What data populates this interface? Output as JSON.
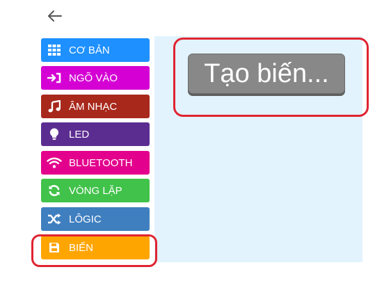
{
  "back_icon": "arrow-left-icon",
  "categories": [
    {
      "label": "CƠ BẢN",
      "color": "#1e90ff",
      "icon": "grid-icon"
    },
    {
      "label": "NGÕ VÀO",
      "color": "#d400d4",
      "icon": "login-icon"
    },
    {
      "label": "ÂM NHẠC",
      "color": "#a8281b",
      "icon": "music-note-icon"
    },
    {
      "label": "LED",
      "color": "#5c2d91",
      "icon": "lightbulb-icon"
    },
    {
      "label": "BLUETOOTH",
      "color": "#e3008c",
      "icon": "wifi-icon"
    },
    {
      "label": "VÒNG LẶP",
      "color": "#41c24a",
      "icon": "refresh-icon"
    },
    {
      "label": "LÔGIC",
      "color": "#3f7fbf",
      "icon": "shuffle-icon"
    },
    {
      "label": "BIẾN",
      "color": "#ffa500",
      "icon": "save-icon"
    }
  ],
  "workspace": {
    "make_variable_label": "Tạo biến..."
  },
  "highlight_color": "#e02430"
}
